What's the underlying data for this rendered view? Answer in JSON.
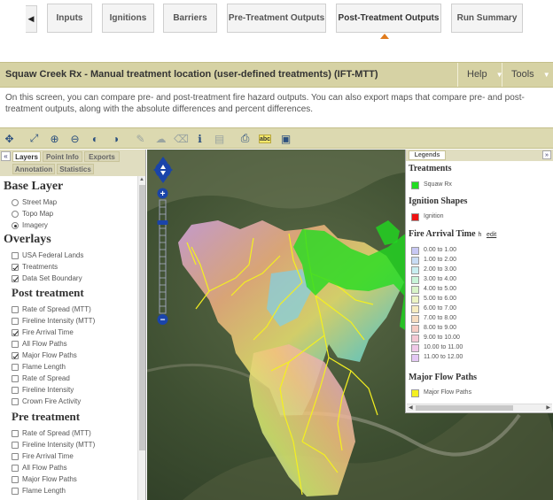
{
  "steps": {
    "back_glyph": "◀",
    "items": [
      {
        "label": "Inputs"
      },
      {
        "label": "Ignitions"
      },
      {
        "label": "Barriers"
      },
      {
        "label": "Pre-Treatment Outputs"
      },
      {
        "label": "Post-Treatment Outputs"
      },
      {
        "label": "Run Summary"
      }
    ],
    "active_index": 4
  },
  "header": {
    "title": "Squaw Creek Rx - Manual treatment location (user-defined treatments) (IFT-MTT)",
    "help_label": "Help",
    "tools_label": "Tools",
    "caret": "▼"
  },
  "description": "On this screen, you can compare pre- and post-treatment fire hazard outputs. You can also export maps that compare pre- and post-treatment outputs, along with the absolute differences and percent differences.",
  "toolbar": {
    "tools": [
      "pan-tool-icon",
      "zoom-extent-icon",
      "zoom-in-icon",
      "zoom-out-icon",
      "zoom-previous-icon",
      "zoom-next-icon",
      "draw-line-icon",
      "measure-icon",
      "clear-icon",
      "identify-icon",
      "print-icon",
      "export-map-icon",
      "label-icon",
      "bookmark-icon"
    ],
    "abc_label": "abc"
  },
  "left_panel": {
    "collapse_glyph": "«",
    "tabs": [
      "Layers",
      "Point Info",
      "Exports",
      "Annotation",
      "Statistics"
    ],
    "active_tab": "Layers",
    "base_layer": {
      "heading": "Base Layer",
      "options": [
        {
          "label": "Street Map",
          "selected": false
        },
        {
          "label": "Topo Map",
          "selected": false
        },
        {
          "label": "Imagery",
          "selected": true
        }
      ]
    },
    "overlays": {
      "heading": "Overlays",
      "items": [
        {
          "label": "USA Federal Lands",
          "checked": false
        },
        {
          "label": "Treatments",
          "checked": true
        },
        {
          "label": "Data Set Boundary",
          "checked": true
        }
      ]
    },
    "post_treatment": {
      "heading": "Post treatment",
      "items": [
        {
          "label": "Rate of Spread (MTT)",
          "checked": false
        },
        {
          "label": "Fireline Intensity (MTT)",
          "checked": false
        },
        {
          "label": "Fire Arrival Time",
          "checked": true
        },
        {
          "label": "All Flow Paths",
          "checked": false
        },
        {
          "label": "Major Flow Paths",
          "checked": true
        },
        {
          "label": "Flame Length",
          "checked": false
        },
        {
          "label": "Rate of Spread",
          "checked": false
        },
        {
          "label": "Fireline Intensity",
          "checked": false
        },
        {
          "label": "Crown Fire Activity",
          "checked": false
        }
      ]
    },
    "pre_treatment": {
      "heading": "Pre treatment",
      "items": [
        {
          "label": "Rate of Spread (MTT)",
          "checked": false
        },
        {
          "label": "Fireline Intensity (MTT)",
          "checked": false
        },
        {
          "label": "Fire Arrival Time",
          "checked": false
        },
        {
          "label": "All Flow Paths",
          "checked": false
        },
        {
          "label": "Major Flow Paths",
          "checked": false
        },
        {
          "label": "Flame Length",
          "checked": false
        }
      ]
    }
  },
  "legend": {
    "tab_label": "Legends",
    "expand_glyph": "»",
    "treatments": {
      "title": "Treatments",
      "items": [
        {
          "label": "Squaw Rx",
          "color": "#22dd22"
        }
      ]
    },
    "ignitions": {
      "title": "Ignition Shapes",
      "items": [
        {
          "label": "Ignition",
          "color": "#ee1111"
        }
      ]
    },
    "arrival": {
      "title": "Fire Arrival Time",
      "unit": "h",
      "edit_label": "edit",
      "items": [
        {
          "label": "0.00 to 1.00",
          "color": "#c8c8f4"
        },
        {
          "label": "1.00 to 2.00",
          "color": "#c8dcf4"
        },
        {
          "label": "2.00 to 3.00",
          "color": "#c8eef0"
        },
        {
          "label": "3.00 to 4.00",
          "color": "#c8f4d8"
        },
        {
          "label": "4.00 to 5.00",
          "color": "#d8f4c8"
        },
        {
          "label": "5.00 to 6.00",
          "color": "#ecf4c4"
        },
        {
          "label": "6.00 to 7.00",
          "color": "#f6ecc0"
        },
        {
          "label": "7.00 to 8.00",
          "color": "#f6dcc0"
        },
        {
          "label": "8.00 to 9.00",
          "color": "#f6ccc4"
        },
        {
          "label": "9.00 to 10.00",
          "color": "#f4c8d4"
        },
        {
          "label": "10.00 to 11.00",
          "color": "#f0c8e8"
        },
        {
          "label": "11.00 to 12.00",
          "color": "#e4c8f4"
        }
      ]
    },
    "flow_paths": {
      "title": "Major Flow Paths",
      "items": [
        {
          "label": "Major Flow Paths",
          "color": "#f4f020"
        }
      ]
    }
  },
  "map": {
    "zoom_in_glyph": "+",
    "zoom_out_glyph": "−",
    "accent": "#1a44aa"
  }
}
